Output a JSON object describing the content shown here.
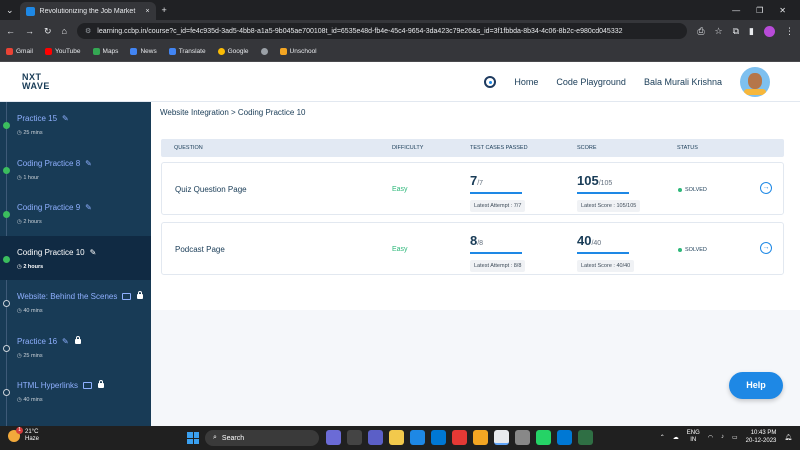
{
  "browser": {
    "tab_title": "Revolutionizing the Job Market",
    "url": "learning.ccbp.in/course?c_id=fe4c935d-3ad5-4bb8-a1a5-9b045ae700108t_id=6535e48d-fb4e-45c4-9654-3da423c79e26&s_id=3f1fbbda-8b34-4c06-8b2c-e980cd045332",
    "bookmarks": [
      "Gmail",
      "YouTube",
      "Maps",
      "News",
      "Translate",
      "Google",
      "Unschool"
    ]
  },
  "header": {
    "logo_line1": "NXT",
    "logo_line2": "WAVE",
    "nav_home": "Home",
    "nav_playground": "Code Playground",
    "user_name": "Bala Murali Krishna"
  },
  "sidebar": {
    "items": [
      {
        "title": "Practice 15",
        "duration": "25 mins"
      },
      {
        "title": "Coding Practice 8",
        "duration": "1 hour"
      },
      {
        "title": "Coding Practice 9",
        "duration": "2 hours"
      },
      {
        "title": "Coding Practice 10",
        "duration": "2 hours"
      },
      {
        "title": "Website: Behind the Scenes",
        "duration": "40 mins"
      },
      {
        "title": "Practice 16",
        "duration": "25 mins"
      },
      {
        "title": "HTML Hyperlinks",
        "duration": "40 mins"
      }
    ]
  },
  "main": {
    "breadcrumb": "Website Integration > Coding Practice 10",
    "columns": [
      "QUESTION",
      "DIFFICULTY",
      "TEST CASES PASSED",
      "SCORE",
      "STATUS"
    ],
    "rows": [
      {
        "question": "Quiz Question Page",
        "difficulty": "Easy",
        "tests_passed": "7",
        "tests_total": "/7",
        "latest_attempt": "Latest Attempt : 7/7",
        "score": "105",
        "score_total": "/105",
        "latest_score": "Latest Score : 105/105",
        "status": "SOLVED"
      },
      {
        "question": "Podcast Page",
        "difficulty": "Easy",
        "tests_passed": "8",
        "tests_total": "/8",
        "latest_attempt": "Latest Attempt : 8/8",
        "score": "40",
        "score_total": "/40",
        "latest_score": "Latest Score : 40/40",
        "status": "SOLVED"
      }
    ],
    "help_label": "Help"
  },
  "taskbar": {
    "temperature": "21°C",
    "weather": "Haze",
    "search_placeholder": "Search",
    "notification_count": "1",
    "lang_line1": "ENG",
    "lang_line2": "IN",
    "time": "10:43 PM",
    "date": "20-12-2023"
  },
  "colors": {
    "sidebar_bg": "#183b56",
    "accent": "#1e88e5",
    "success": "#2eb87a"
  }
}
